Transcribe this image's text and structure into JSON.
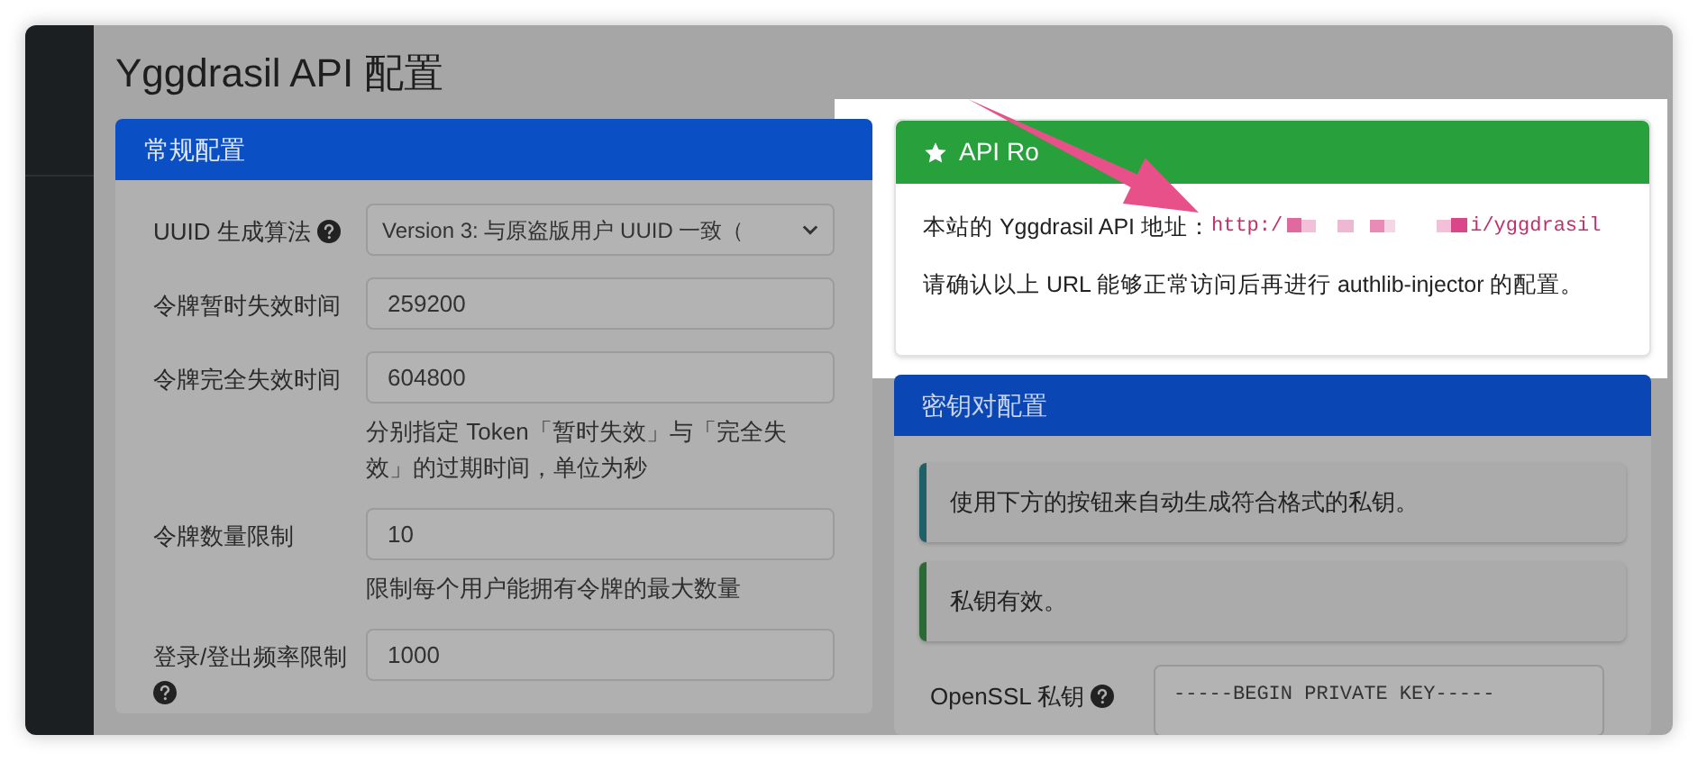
{
  "page_title": "Yggdrasil API 配置",
  "general_config": {
    "title": "常规配置",
    "fields": [
      {
        "kind": "select",
        "label": "UUID 生成算法",
        "help_icon": true,
        "value": "Version 3: 与原盗版用户 UUID 一致（"
      },
      {
        "kind": "input",
        "label": "令牌暂时失效时间",
        "help_icon": false,
        "value": "259200"
      },
      {
        "kind": "input",
        "label": "令牌完全失效时间",
        "help_icon": false,
        "value": "604800",
        "help": "分别指定 Token「暂时失效」与「完全失效」的过期时间，单位为秒"
      },
      {
        "kind": "input",
        "label": "令牌数量限制",
        "help_icon": false,
        "value": "10",
        "help": "限制每个用户能拥有令牌的最大数量"
      },
      {
        "kind": "input",
        "label": "登录/登出频率限制",
        "help_icon": true,
        "value": "1000"
      }
    ]
  },
  "api_root": {
    "title": "API Ro",
    "address_label": "本站的 Yggdrasil API 地址：",
    "url_start": "http:/",
    "url_end": "i/yggdrasil",
    "note": "请确认以上 URL 能够正常访问后再进行 authlib-injector 的配置。"
  },
  "keypair": {
    "title": "密钥对配置",
    "callouts": [
      {
        "text": "使用下方的按钮来自动生成符合格式的私钥。",
        "color": "#1f6068"
      },
      {
        "text": "私钥有效。",
        "color": "#2c6a35"
      }
    ],
    "private_key": {
      "label": "OpenSSL 私钥",
      "help_icon": true,
      "value": "-----BEGIN PRIVATE KEY-----"
    }
  }
}
